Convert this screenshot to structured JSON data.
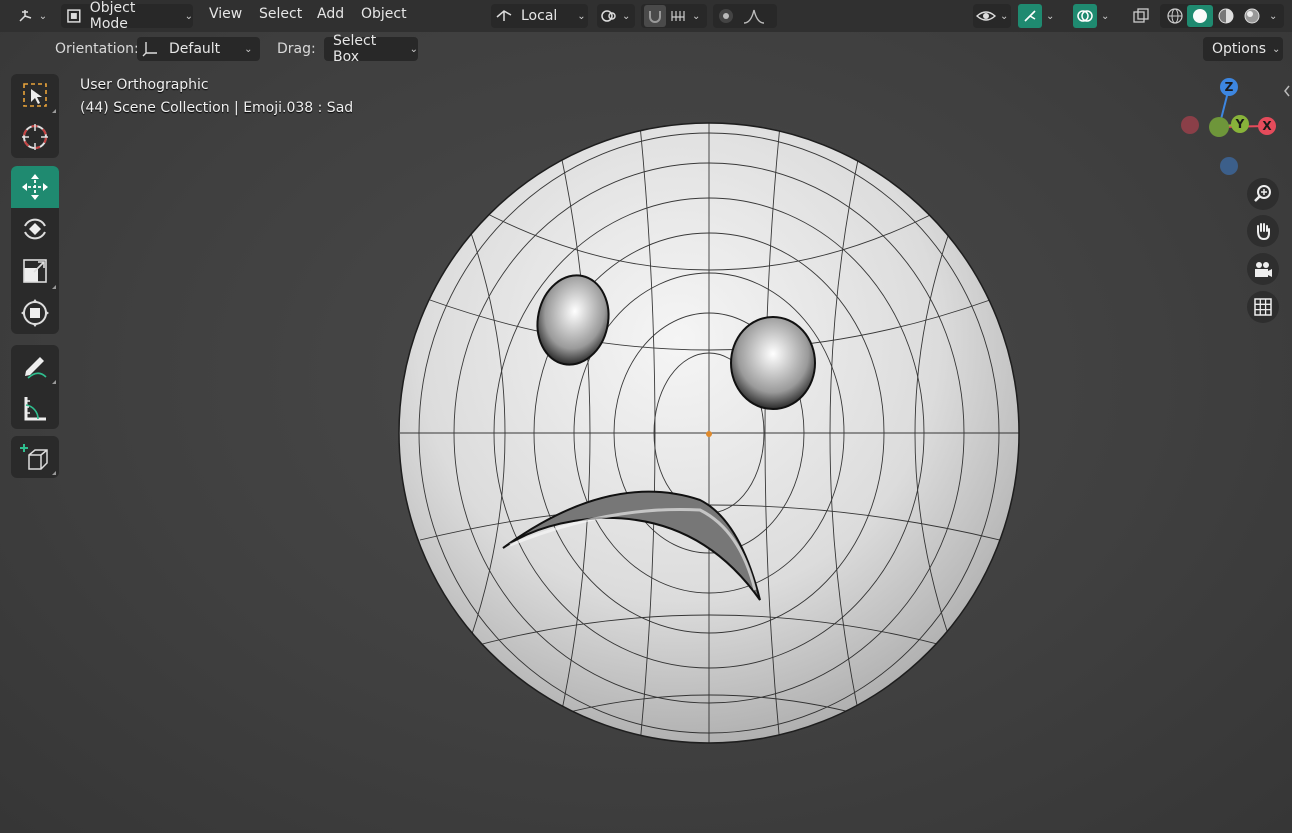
{
  "header": {
    "editor_type_icon": "viewport-icon",
    "mode": {
      "label": "Object Mode",
      "icon": "object-mode-icon"
    },
    "menu": [
      "View",
      "Select",
      "Add",
      "Object"
    ],
    "transform_orientation": {
      "label": "Local",
      "icon": "local-orientation-icon"
    },
    "pivot_icon": "pivot-icon",
    "snap_icon": "magnet-icon",
    "snap_target_icon": "snap-increment-icon",
    "proportional_icon": "proportional-edit-icon",
    "falloff_icon": "falloff-curve-icon",
    "visibility_icon": "eye-icon",
    "gizmo_icon": "gizmo-toggle-icon",
    "overlay_icon": "overlay-icon",
    "xray_icon": "xray-icon",
    "shading_modes": [
      "wireframe",
      "solid",
      "material-preview",
      "rendered"
    ],
    "active_shading": "solid",
    "accent_color": "#1f8a70"
  },
  "tool_settings": {
    "orientation_label": "Orientation:",
    "orientation_value": "Default",
    "drag_label": "Drag:",
    "drag_value": "Select Box",
    "options_label": "Options"
  },
  "toolbar": {
    "groups": [
      [
        "select-box-tool",
        "cursor-tool"
      ],
      [
        "move-tool",
        "rotate-tool",
        "scale-tool",
        "transform-tool"
      ],
      [
        "annotate-tool",
        "measure-tool"
      ],
      [
        "add-cube-tool"
      ]
    ],
    "active_tool": "move-tool"
  },
  "viewport": {
    "view_name": "User Orthographic",
    "scene_info": "(44) Scene Collection | Emoji.038 : Sad"
  },
  "nav_gizmo": {
    "axes": {
      "z": "Z",
      "y": "Y",
      "x": "X"
    },
    "colors": {
      "x": "#e54b5b",
      "y": "#88b33a",
      "z": "#3d86e0"
    },
    "buttons": [
      "zoom-icon",
      "hand-pan-icon",
      "camera-icon",
      "grid-icon"
    ]
  }
}
